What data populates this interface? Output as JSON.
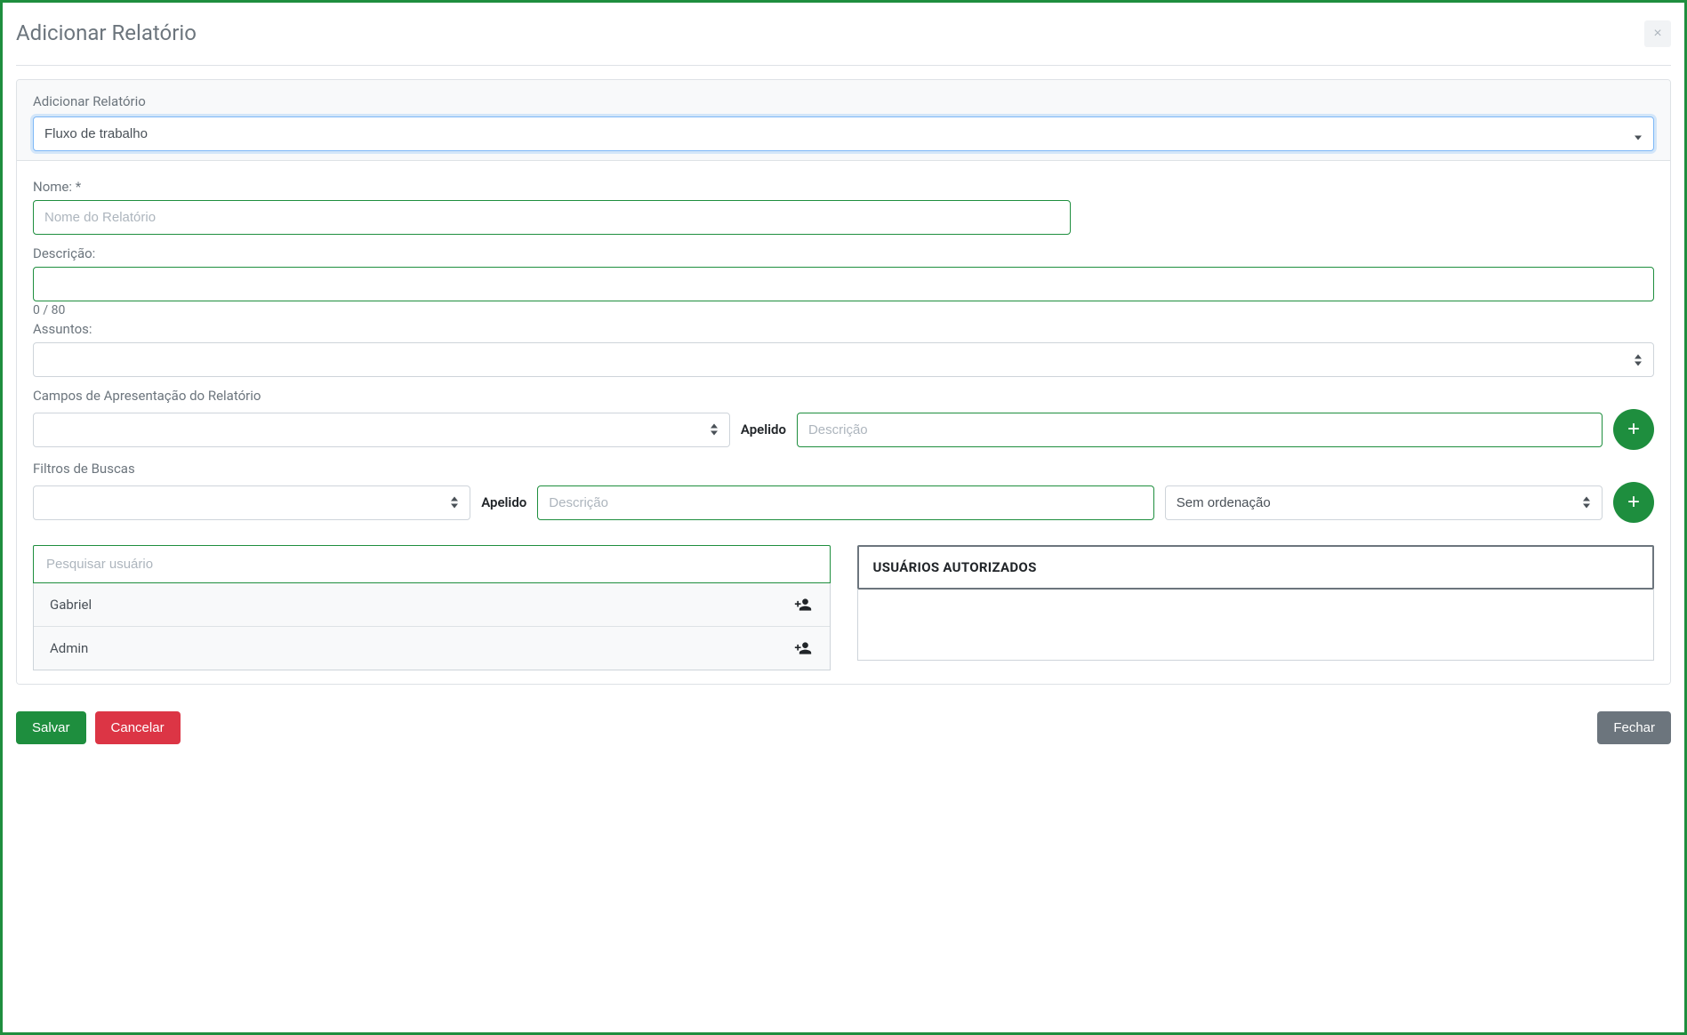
{
  "modal": {
    "title": "Adicionar Relatório",
    "close_symbol": "×"
  },
  "panel": {
    "header_label": "Adicionar Relatório",
    "type_selected": "Fluxo de trabalho"
  },
  "form": {
    "name_label": "Nome: *",
    "name_placeholder": "Nome do Relatório",
    "description_label": "Descrição:",
    "description_value": "",
    "char_count": "0 / 80",
    "subjects_label": "Assuntos:",
    "presentation_label": "Campos de Apresentação do Relatório",
    "apelido_label": "Apelido",
    "apelido_placeholder": "Descrição",
    "filters_label": "Filtros de Buscas",
    "filter_apelido_label": "Apelido",
    "filter_apelido_placeholder": "Descrição",
    "order_selected": "Sem ordenação"
  },
  "users": {
    "search_placeholder": "Pesquisar usuário",
    "authorized_header": "USUÁRIOS AUTORIZADOS",
    "available": [
      {
        "name": "Gabriel"
      },
      {
        "name": "Admin"
      }
    ]
  },
  "footer": {
    "save": "Salvar",
    "cancel": "Cancelar",
    "close": "Fechar"
  }
}
